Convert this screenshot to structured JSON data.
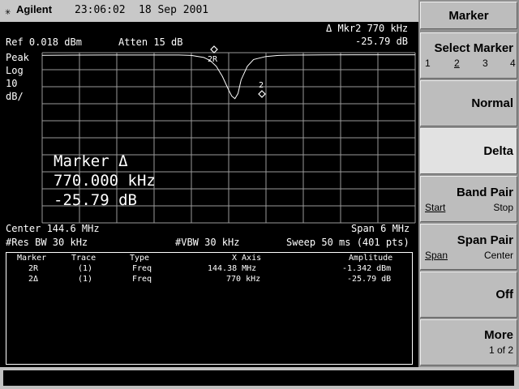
{
  "header": {
    "brand": "Agilent",
    "time": "23:06:02",
    "date": "18 Sep 2001"
  },
  "readout": {
    "mkr": "Δ Mkr2  770 kHz",
    "mkr_amp": "-25.79 dB",
    "ref": "Ref 0.018 dBm",
    "atten": "Atten 15 dB",
    "scale1": "Peak",
    "scale2": "Log",
    "scale3": "10",
    "scale4": "dB/",
    "marker_title": "Marker Δ",
    "marker_freq": "770.000 kHz",
    "marker_amp": "-25.79 dB",
    "marker1_label": "2R",
    "marker2_label": "2",
    "center": "Center 144.6 MHz",
    "span": "Span 6 MHz",
    "rbw": "#Res BW 30 kHz",
    "vbw": "#VBW 30 kHz",
    "sweep": "Sweep 50 ms (401 pts)"
  },
  "trace": {
    "ref_level_dbm": 0.018,
    "db_per_div": 10,
    "span_mhz": 6,
    "center_mhz": 144.6,
    "points_freq_offset_mhz": [
      -3.0,
      -2.5,
      -2.0,
      -1.5,
      -1.2,
      -1.0,
      -0.8,
      -0.6,
      -0.4,
      -0.3,
      -0.2,
      -0.1,
      0.0,
      0.05,
      0.1,
      0.15,
      0.2,
      0.3,
      0.4,
      0.6,
      0.8,
      1.0,
      1.5,
      2.0,
      2.5,
      3.0
    ],
    "points_amp_dbm": [
      -1.5,
      -1.4,
      -1.35,
      -1.342,
      -1.342,
      -1.34,
      -1.36,
      -1.6,
      -2.8,
      -4.5,
      -8.0,
      -14.0,
      -22.0,
      -25.5,
      -27.0,
      -24.0,
      -16.0,
      -8.0,
      -4.0,
      -2.2,
      -1.6,
      -1.4,
      -1.3,
      -1.2,
      -1.2,
      -1.2
    ]
  },
  "table": {
    "headers": [
      "Marker",
      "Trace",
      "Type",
      "X Axis",
      "Amplitude"
    ],
    "rows": [
      [
        "2R",
        "(1)",
        "Freq",
        "144.38 MHz",
        "-1.342 dBm"
      ],
      [
        "2Δ",
        "(1)",
        "Freq",
        "770 kHz",
        "-25.79 dB"
      ]
    ]
  },
  "softkeys": {
    "title": "Marker",
    "select_marker": "Select Marker",
    "select_nums": [
      "1",
      "2",
      "3",
      "4"
    ],
    "normal": "Normal",
    "delta": "Delta",
    "band_pair": "Band Pair",
    "band_start": "Start",
    "band_stop": "Stop",
    "span_pair": "Span Pair",
    "span_span": "Span",
    "span_center": "Center",
    "off": "Off",
    "more": "More",
    "more_page": "1 of 2"
  }
}
